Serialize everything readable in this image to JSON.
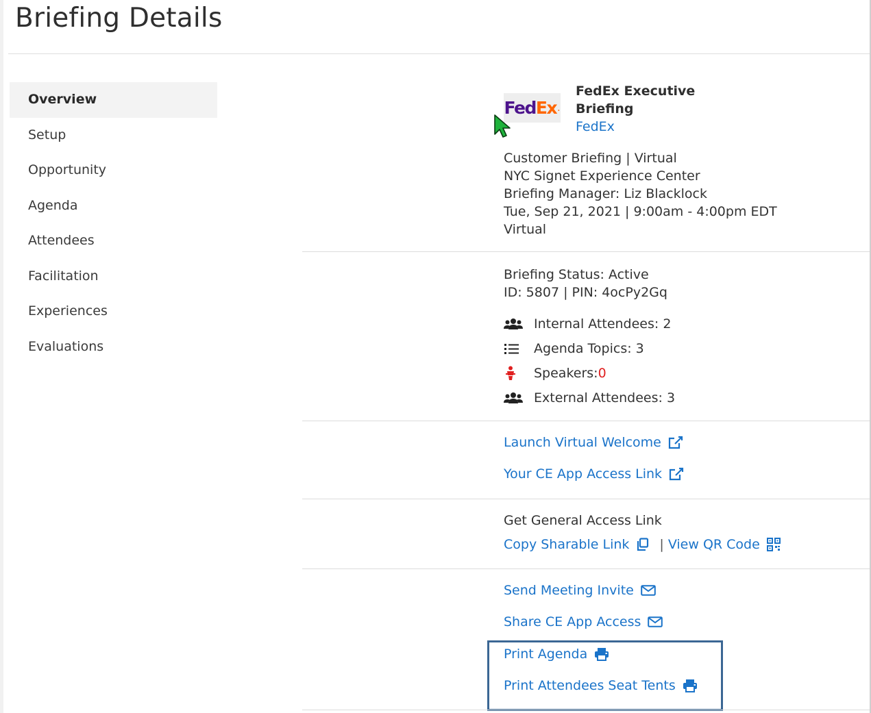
{
  "page": {
    "title": "Briefing Details"
  },
  "sidebar": {
    "items": [
      {
        "label": "Overview",
        "active": true
      },
      {
        "label": "Setup"
      },
      {
        "label": "Opportunity"
      },
      {
        "label": "Agenda"
      },
      {
        "label": "Attendees"
      },
      {
        "label": "Facilitation"
      },
      {
        "label": "Experiences"
      },
      {
        "label": "Evaluations"
      }
    ]
  },
  "briefing": {
    "logo": {
      "part1": "Fed",
      "part2": "Ex",
      "part3": "."
    },
    "name": "FedEx Executive Briefing",
    "company": "FedEx",
    "type_line": "Customer Briefing | Virtual",
    "location": "NYC Signet Experience Center",
    "manager": "Briefing Manager: Liz Blacklock",
    "datetime": "Tue, Sep 21, 2021 | 9:00am - 4:00pm EDT",
    "mode": "Virtual"
  },
  "status": {
    "status_line": "Briefing Status: Active",
    "id_line": "ID: 5807 | PIN: 4ocPy2Gq",
    "internal_attendees": "Internal Attendees: 2",
    "agenda_topics": "Agenda Topics: 3",
    "speakers_label": "Speakers: ",
    "speakers_count": "0",
    "external_attendees": "External Attendees: 3"
  },
  "links": {
    "launch_virtual_welcome": "Launch Virtual Welcome",
    "ce_app_access_link": "Your CE App Access Link",
    "general_access_heading": "Get General Access Link",
    "copy_sharable_link": "Copy Sharable Link",
    "separator": "|",
    "view_qr_code": "View QR Code",
    "send_meeting_invite": "Send Meeting Invite",
    "share_ce_app_access": "Share CE App Access",
    "print_agenda": "Print Agenda",
    "print_seat_tents": "Print Attendees Seat Tents"
  },
  "colors": {
    "link": "#1a73c9",
    "highlight_border": "#3b6794",
    "fedex_purple": "#4d148c",
    "fedex_orange": "#ff6600",
    "alert_red": "#e02020"
  },
  "icons": {
    "attendees": "users-icon",
    "agenda": "list-icon",
    "speaker": "speaker-icon",
    "external": "users-icon",
    "external_link": "external-link-icon",
    "copy": "copy-icon",
    "qr": "qr-code-icon",
    "mail": "envelope-icon",
    "print": "printer-icon"
  }
}
